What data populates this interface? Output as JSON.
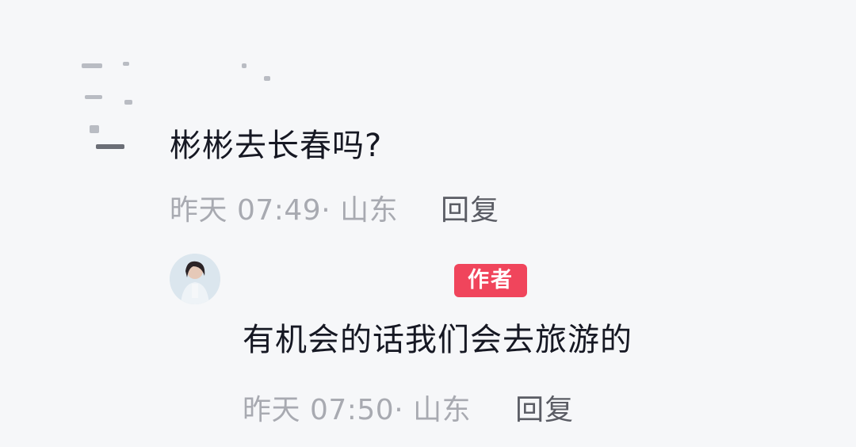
{
  "comment": {
    "text": "彬彬去长春吗?",
    "meta": "昨天 07:49· 山东",
    "reply_label": "回复"
  },
  "reply": {
    "badge": "作者",
    "text": "有机会的话我们会去旅游的",
    "meta": "昨天 07:50· 山东",
    "reply_label": "回复"
  },
  "colors": {
    "background": "#f6f7f9",
    "text": "#161823",
    "meta": "#a8aab1",
    "reply": "#5a5c64",
    "badge": "#f0455c"
  }
}
